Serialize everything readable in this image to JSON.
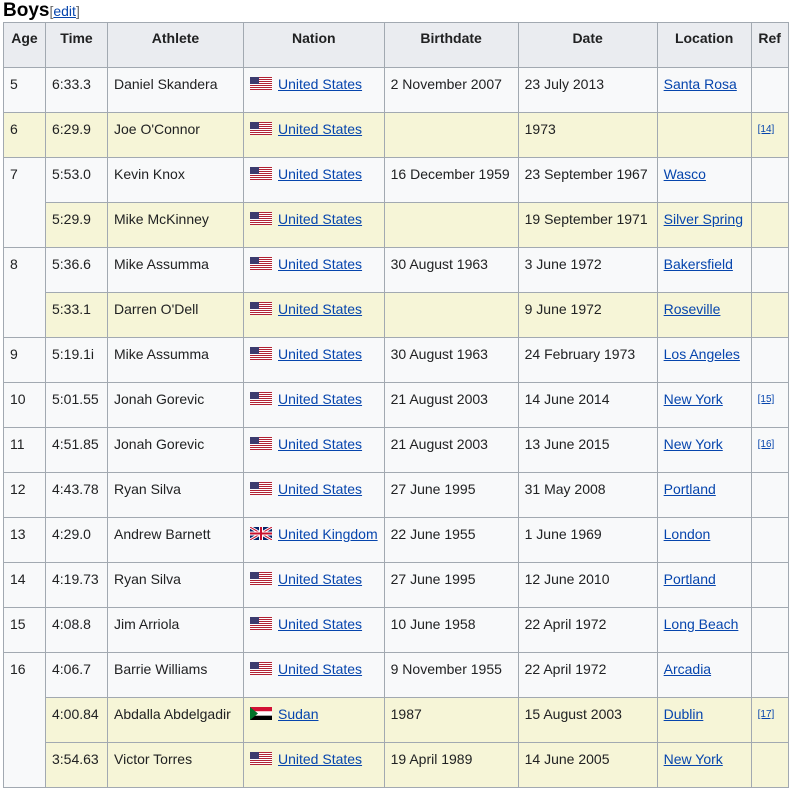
{
  "section": {
    "title": "Boys",
    "edit_open": "[",
    "edit_label": "edit",
    "edit_close": "]"
  },
  "table": {
    "headers": [
      "Age",
      "Time",
      "Athlete",
      "Nation",
      "Birthdate",
      "Date",
      "Location",
      "Ref"
    ],
    "groups": [
      {
        "age": "5",
        "rows": [
          {
            "time": "6:33.3",
            "athlete": "Daniel Skandera",
            "flag": "us-flag-icon",
            "nation": "United States",
            "birthdate": "2 November 2007",
            "date": "23 July 2013",
            "location": "Santa Rosa",
            "ref": "",
            "hl": false
          }
        ]
      },
      {
        "age": "6",
        "rows": [
          {
            "time": "6:29.9",
            "athlete": "Joe O'Connor",
            "flag": "us-flag-icon",
            "nation": "United States",
            "birthdate": "",
            "date": "1973",
            "location": "",
            "ref": "[14]",
            "hl": true
          }
        ]
      },
      {
        "age": "7",
        "rows": [
          {
            "time": "5:53.0",
            "athlete": "Kevin Knox",
            "flag": "us-flag-icon",
            "nation": "United States",
            "birthdate": "16 December 1959",
            "date": "23 September 1967",
            "location": "Wasco",
            "ref": "",
            "hl": false
          },
          {
            "time": "5:29.9",
            "athlete": "Mike McKinney",
            "flag": "us-flag-icon",
            "nation": "United States",
            "birthdate": "",
            "date": "19 September 1971",
            "location": "Silver Spring",
            "ref": "",
            "hl": true
          }
        ]
      },
      {
        "age": "8",
        "rows": [
          {
            "time": "5:36.6",
            "athlete": "Mike Assumma",
            "flag": "us-flag-icon",
            "nation": "United States",
            "birthdate": "30 August 1963",
            "date": "3 June 1972",
            "location": "Bakersfield",
            "ref": "",
            "hl": false
          },
          {
            "time": "5:33.1",
            "athlete": "Darren O'Dell",
            "flag": "us-flag-icon",
            "nation": "United States",
            "birthdate": "",
            "date": "9 June 1972",
            "location": "Roseville",
            "ref": "",
            "hl": true
          }
        ]
      },
      {
        "age": "9",
        "rows": [
          {
            "time": "5:19.1i",
            "athlete": "Mike Assumma",
            "flag": "us-flag-icon",
            "nation": "United States",
            "birthdate": "30 August 1963",
            "date": "24 February 1973",
            "location": "Los Angeles",
            "ref": "",
            "hl": false
          }
        ]
      },
      {
        "age": "10",
        "rows": [
          {
            "time": "5:01.55",
            "athlete": "Jonah Gorevic",
            "flag": "us-flag-icon",
            "nation": "United States",
            "birthdate": "21 August 2003",
            "date": "14 June 2014",
            "location": "New York",
            "ref": "[15]",
            "hl": false
          }
        ]
      },
      {
        "age": "11",
        "rows": [
          {
            "time": "4:51.85",
            "athlete": "Jonah Gorevic",
            "flag": "us-flag-icon",
            "nation": "United States",
            "birthdate": "21 August 2003",
            "date": "13 June 2015",
            "location": "New York",
            "ref": "[16]",
            "hl": false
          }
        ]
      },
      {
        "age": "12",
        "rows": [
          {
            "time": "4:43.78",
            "athlete": "Ryan Silva",
            "flag": "us-flag-icon",
            "nation": "United States",
            "birthdate": "27 June 1995",
            "date": "31 May 2008",
            "location": "Portland",
            "ref": "",
            "hl": false
          }
        ]
      },
      {
        "age": "13",
        "rows": [
          {
            "time": "4:29.0",
            "athlete": "Andrew Barnett",
            "flag": "uk-flag-icon",
            "nation": "United Kingdom",
            "birthdate": "22 June 1955",
            "date": "1 June 1969",
            "location": "London",
            "ref": "",
            "hl": false
          }
        ]
      },
      {
        "age": "14",
        "rows": [
          {
            "time": "4:19.73",
            "athlete": "Ryan Silva",
            "flag": "us-flag-icon",
            "nation": "United States",
            "birthdate": "27 June 1995",
            "date": "12 June 2010",
            "location": "Portland",
            "ref": "",
            "hl": false
          }
        ]
      },
      {
        "age": "15",
        "rows": [
          {
            "time": "4:08.8",
            "athlete": "Jim Arriola",
            "flag": "us-flag-icon",
            "nation": "United States",
            "birthdate": "10 June 1958",
            "date": "22 April 1972",
            "location": "Long Beach",
            "ref": "",
            "hl": false
          }
        ]
      },
      {
        "age": "16",
        "rows": [
          {
            "time": "4:06.7",
            "athlete": "Barrie Williams",
            "flag": "us-flag-icon",
            "nation": "United States",
            "birthdate": "9 November 1955",
            "date": "22 April 1972",
            "location": "Arcadia",
            "ref": "",
            "hl": false
          },
          {
            "time": "4:00.84",
            "athlete": "Abdalla Abdelgadir",
            "flag": "sudan-flag-icon",
            "nation": "Sudan",
            "birthdate": "1987",
            "date": "15 August 2003",
            "location": "Dublin",
            "ref": "[17]",
            "hl": true
          },
          {
            "time": "3:54.63",
            "athlete": "Victor Torres",
            "flag": "us-flag-icon",
            "nation": "United States",
            "birthdate": "19 April 1989",
            "date": "14 June 2005",
            "location": "New York",
            "ref": "",
            "hl": true
          }
        ]
      }
    ]
  }
}
